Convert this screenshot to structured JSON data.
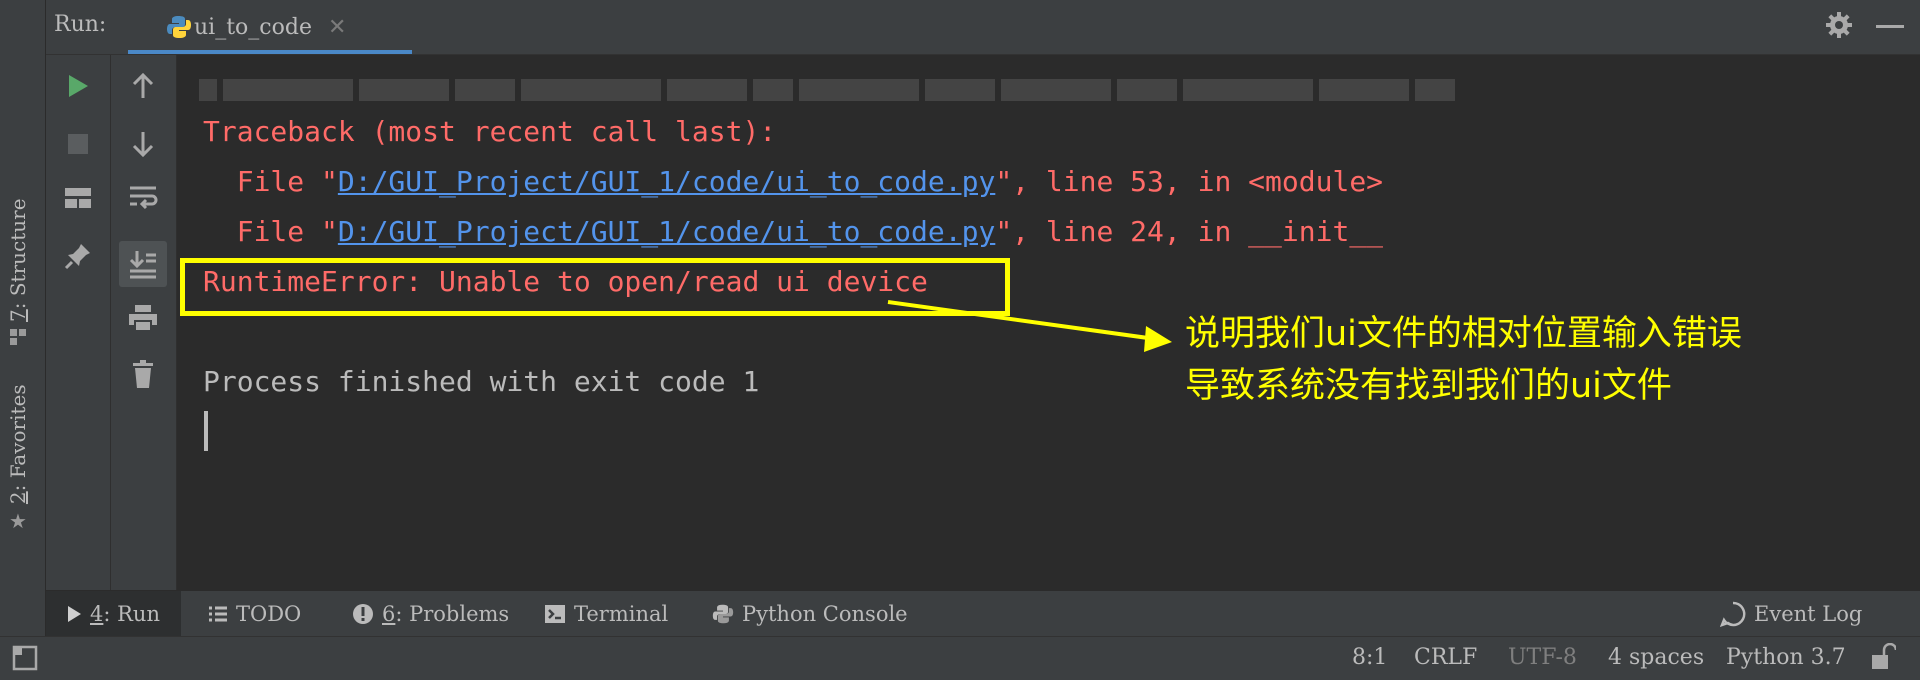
{
  "header": {
    "run_label": "Run:",
    "tab_title": "ui_to_code",
    "tab_close": "✕"
  },
  "left_strip": {
    "structure_num": "7",
    "structure_text": ": Structure",
    "favorites_num": "2",
    "favorites_text": ": Favorites"
  },
  "console": {
    "traceback": "Traceback (most recent call last):",
    "file1_prefix": "  File \"",
    "file1_path": "D:/GUI_Project/GUI_1/code/ui_to_code.py",
    "file1_suffix": "\", line 53, in <module>",
    "file2_prefix": "  File \"",
    "file2_path": "D:/GUI_Project/GUI_1/code/ui_to_code.py",
    "file2_suffix": "\", line 24, in __init__",
    "error": "RuntimeError: Unable to open/read ui device",
    "process": "Process finished with exit code 1"
  },
  "annotation": {
    "line1": "说明我们ui文件的相对位置输入错误",
    "line2": "导致系统没有找到我们的ui文件"
  },
  "bottom_tabs": {
    "run_num": "4",
    "run_text": ": Run",
    "todo": "TODO",
    "problems_num": "6",
    "problems_text": ": Problems",
    "terminal": "Terminal",
    "python_console": "Python Console",
    "event_log": "Event Log"
  },
  "status": {
    "position": "8:1",
    "line_sep": "CRLF",
    "encoding": "UTF-8",
    "indent": "4 spaces",
    "interpreter": "Python 3.7"
  },
  "colors": {
    "accent": "#4a88c7",
    "error": "#ff6b68",
    "link": "#5394ec",
    "highlight": "#ffff00",
    "run_green": "#59a869"
  }
}
